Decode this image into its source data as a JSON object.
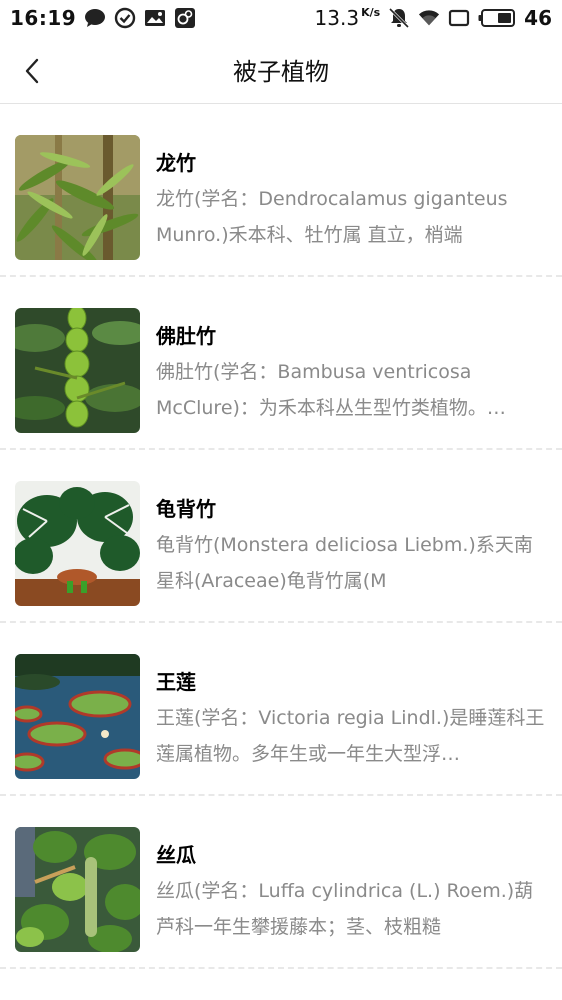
{
  "status_bar": {
    "time": "16:19",
    "net_speed": "13.3",
    "net_unit": "K/s",
    "battery": "46",
    "icons": [
      "chat-bubble-icon",
      "check-circle-icon",
      "image-notification-icon",
      "app-notification-icon",
      "mute-icon",
      "wifi-icon",
      "screen-icon",
      "battery-icon"
    ]
  },
  "header": {
    "title": "被子植物",
    "back_icon": "chevron-left-icon"
  },
  "plants": [
    {
      "name": "龙竹",
      "description": "龙竹(学名：Dendrocalamus giganteus Munro.)禾本科、牡竹属 直立，梢端"
    },
    {
      "name": "佛肚竹",
      "description": "佛肚竹(学名：Bambusa ventricosa McClure)：为禾本科丛生型竹类植物。…"
    },
    {
      "name": "龟背竹",
      "description": "龟背竹(Monstera deliciosa Liebm.)系天南星科(Araceae)龟背竹属(M"
    },
    {
      "name": "王莲",
      "description": "王莲(学名：Victoria regia Lindl.)是睡莲科王莲属植物。多年生或一年生大型浮…"
    },
    {
      "name": "丝瓜",
      "description": "丝瓜(学名：Luffa cylindrica (L.) Roem.)葫芦科一年生攀援藤本；茎、枝粗糙"
    }
  ],
  "colors": {
    "title_text": "#111111",
    "description_text": "#8a8a8a",
    "divider": "#e8e8e8"
  }
}
